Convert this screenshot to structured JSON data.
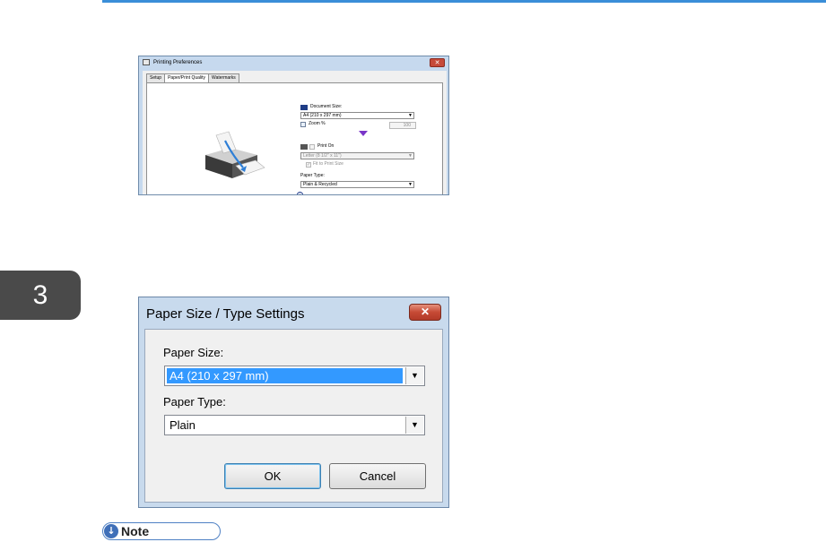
{
  "chapter": {
    "number": "3"
  },
  "printing_preferences": {
    "title": "Printing Preferences",
    "close": "✕",
    "tabs": [
      {
        "label": "Setup"
      },
      {
        "label": "Paper/Print Quality"
      },
      {
        "label": "Watermarks"
      }
    ],
    "document_size": {
      "label": "Document Size:",
      "value": "A4 (210 x 297 mm)"
    },
    "zoom": {
      "label": "Zoom %",
      "value": "100"
    },
    "print_on": {
      "label": "Print On",
      "value": "Letter (8 1/2\" x 11\")"
    },
    "fit_to_print_size": {
      "label": "Fit to Print Size"
    },
    "paper_type": {
      "label": "Paper Type:",
      "value": "Plain & Recycled"
    }
  },
  "paper_size_dialog": {
    "title": "Paper Size / Type Settings",
    "close": "✕",
    "paper_size": {
      "label": "Paper Size:",
      "value": "A4 (210 x 297 mm)"
    },
    "paper_type": {
      "label": "Paper Type:",
      "value": "Plain"
    },
    "ok_label": "OK",
    "cancel_label": "Cancel"
  },
  "note": {
    "label": "Note"
  },
  "colors": {
    "accent": "#3a8ed8",
    "selection": "#3399ff",
    "chapter_tab": "#4a4a4a",
    "close_button": "#c64a35"
  }
}
